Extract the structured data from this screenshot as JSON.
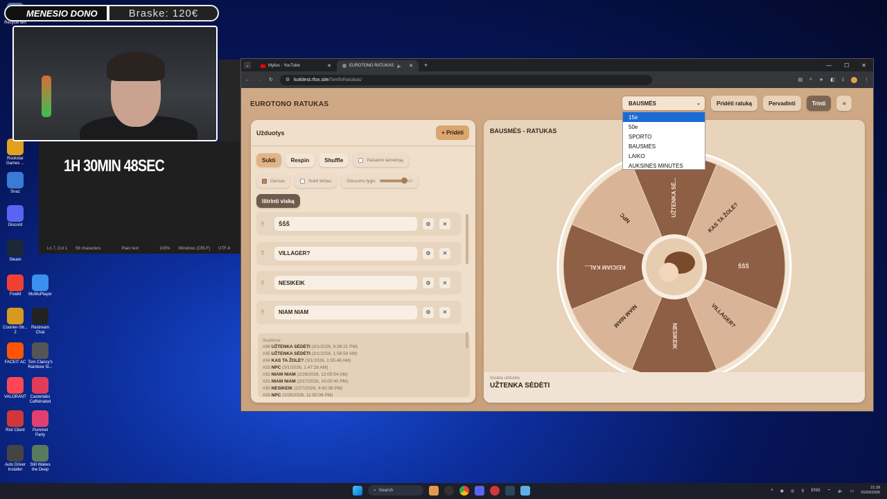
{
  "overlay": {
    "donor_label": "MENESIO DONO",
    "donor_value": "Braske: 120€",
    "timer": "1H 30MIN 48SEC"
  },
  "desktop_icons": [
    {
      "label": "Recycle Bin",
      "color": "#4a6fa8"
    },
    {
      "label": "Rockstar Games ...",
      "color": "#e0a020"
    },
    {
      "label": "Snaz",
      "color": "#3a7bd5"
    },
    {
      "label": "Discord",
      "color": "#5865f2"
    },
    {
      "label": "Steam",
      "color": "#1b2838"
    },
    {
      "label": "FiveM",
      "color": "#f04030"
    },
    {
      "label": "MuMuPlayer",
      "color": "#3b8ff0"
    },
    {
      "label": "Counter-Str... 2",
      "color": "#d69a20"
    },
    {
      "label": "Restream Chat",
      "color": "#222"
    },
    {
      "label": "FACEIT AC",
      "color": "#ff5500"
    },
    {
      "label": "Tom Clancy's Rainbow Si...",
      "color": "#555"
    },
    {
      "label": "VALORANT",
      "color": "#ff4655"
    },
    {
      "label": "Casterlabs Caffeinated",
      "color": "#e03c5a"
    },
    {
      "label": "Riot Client",
      "color": "#d13639"
    },
    {
      "label": "Pummel Party",
      "color": "#e04070"
    },
    {
      "label": "Auto Driver Installer",
      "color": "#444"
    },
    {
      "label": "Still Wakes the Deep",
      "color": "#5a7a60"
    }
  ],
  "notepad_status": [
    "Ln 7, Col 1",
    "59 characters",
    "Plain text",
    "100%",
    "Windows (CRLF)",
    "UTF-8"
  ],
  "browser": {
    "tabs": [
      {
        "title": "Mylios - YouTube",
        "active": false,
        "color": "#ff0000"
      },
      {
        "title": "EUROTONO RATUKAS",
        "active": true,
        "color": "#888"
      }
    ],
    "url_host": "kukitest.rfox.site",
    "url_path": "/SerifoRatukas/"
  },
  "app": {
    "title": "EUROTONO RATUKAS",
    "select_value": "BAUSMĖS",
    "add_wheel": "Pridėti ratuką",
    "rename": "Pervadinti",
    "delete": "Trinti",
    "menu_icon": "≡",
    "dropdown_options": [
      "15e",
      "50e",
      "SPORTO",
      "BAUSMĖS",
      "LAIKO",
      "AUKSINĖS MINUTĖS"
    ],
    "dropdown_selected": 0
  },
  "left_panel": {
    "title": "Užduotys",
    "add_btn": "+ Pridėti",
    "spin": "Sukti",
    "respin": "Respin",
    "shuffle": "Shuffle",
    "remove_winner": "Pašalinti laimėtoją",
    "sound": "Garsas",
    "spin_slow": "Sukti lėčiau",
    "volume": "Garsumo lygis",
    "volume_level": 0.75,
    "clear_all": "Ištrinti viską",
    "tasks": [
      "ŠŠŠ",
      "VILLAGER?",
      "NESIKEIK",
      "NIAM NIAM"
    ],
    "history_label": "Išsukimai:",
    "history": [
      {
        "n": "#36",
        "name": "UŽTENKA SĖDĖTI",
        "time": "(3/1/2026, 9:39:21 PM)"
      },
      {
        "n": "#35",
        "name": "UŽTENKA SĖDĖTI",
        "time": "(3/1/2026, 1:56:59 AM)"
      },
      {
        "n": "#34",
        "name": "KAS TA ŽOLĖ?",
        "time": "(3/1/2026, 1:55:48 AM)"
      },
      {
        "n": "#33",
        "name": "NPC",
        "time": "(3/1/2026, 1:47:28 AM)"
      },
      {
        "n": "#32",
        "name": "NIAM NIAM",
        "time": "(2/28/2026, 12:05:54 AM)"
      },
      {
        "n": "#31",
        "name": "NIAM NIAM",
        "time": "(2/27/2026, 10:00:40 PM)"
      },
      {
        "n": "#30",
        "name": "NESIKEIK",
        "time": "(2/27/2026, 4:42:38 PM)"
      },
      {
        "n": "#29",
        "name": "NPC",
        "time": "(2/26/2026, 11:50:06 PM)"
      }
    ]
  },
  "right_panel": {
    "title": "BAUSMĖS - RATUKAS",
    "segments": [
      "UŽTENKA SĖ...",
      "KAS TA ŽOLĖ?",
      "ŠŠŠ",
      "VILLAGER?",
      "NESIKEIK",
      "NIAM NIAM",
      "KEICIAM KAL...",
      "NPC"
    ],
    "segment_colors": [
      "#8e5e45",
      "#d9b497",
      "#8e5e45",
      "#d9b497",
      "#8e5e45",
      "#d9b497",
      "#8e5e45",
      "#d9b497"
    ],
    "result_label": "Išsukta užduotis",
    "result_value": "UŽTENKA SĖDĖTI"
  },
  "taskbar": {
    "search": "Search",
    "lang": "ENG",
    "time": "21:39",
    "date": "01/03/2026"
  }
}
